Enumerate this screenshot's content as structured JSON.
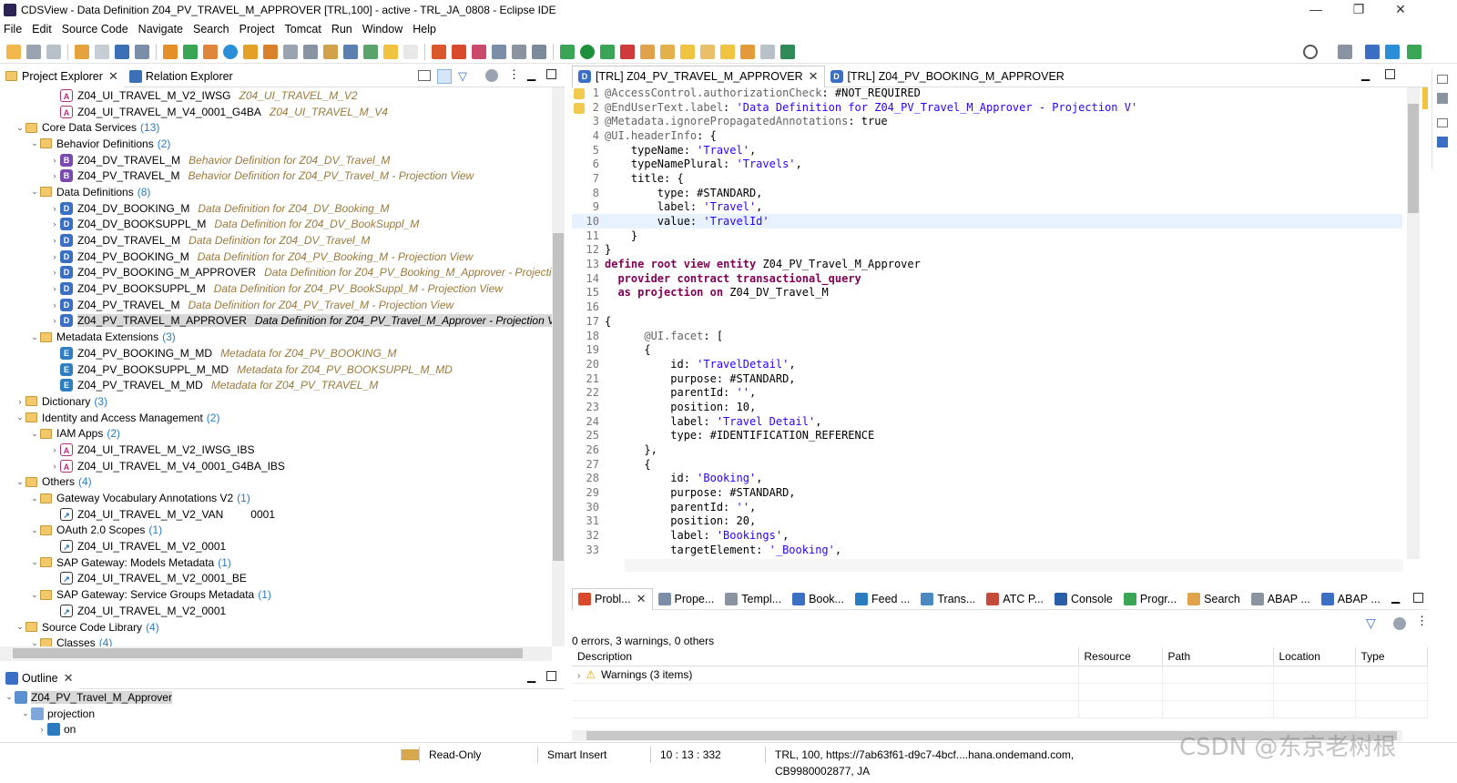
{
  "window": {
    "title": "CDSView - Data Definition Z04_PV_TRAVEL_M_APPROVER [TRL,100] - active - TRL_JA_0808 - Eclipse IDE",
    "minimize": "—",
    "restore": "❐",
    "close": "✕"
  },
  "menu": [
    "File",
    "Edit",
    "Source Code",
    "Navigate",
    "Search",
    "Project",
    "Tomcat",
    "Run",
    "Window",
    "Help"
  ],
  "left_tabs": {
    "project_explorer": "Project Explorer",
    "relation_explorer": "Relation Explorer"
  },
  "tree": [
    {
      "lvl": 3,
      "tw": "",
      "icon": "A",
      "name": "Z04_UI_TRAVEL_M_V2_IWSG",
      "desc": "Z04_UI_TRAVEL_M_V2"
    },
    {
      "lvl": 3,
      "tw": "",
      "icon": "A",
      "name": "Z04_UI_TRAVEL_M_V4_0001_G4BA",
      "desc": "Z04_UI_TRAVEL_M_V4"
    },
    {
      "lvl": 1,
      "tw": "v",
      "icon": "folder",
      "name": "Core Data Services",
      "count": "(13)"
    },
    {
      "lvl": 2,
      "tw": "v",
      "icon": "folder",
      "name": "Behavior Definitions",
      "count": "(2)"
    },
    {
      "lvl": 3,
      "tw": ">",
      "icon": "B",
      "name": "Z04_DV_TRAVEL_M",
      "desc": "Behavior Definition for Z04_DV_Travel_M"
    },
    {
      "lvl": 3,
      "tw": ">",
      "icon": "B",
      "name": "Z04_PV_TRAVEL_M",
      "desc": "Behavior Definition for Z04_PV_Travel_M - Projection View"
    },
    {
      "lvl": 2,
      "tw": "v",
      "icon": "folder",
      "name": "Data Definitions",
      "count": "(8)"
    },
    {
      "lvl": 3,
      "tw": ">",
      "icon": "D",
      "name": "Z04_DV_BOOKING_M",
      "desc": "Data Definition for Z04_DV_Booking_M"
    },
    {
      "lvl": 3,
      "tw": ">",
      "icon": "D",
      "name": "Z04_DV_BOOKSUPPL_M",
      "desc": "Data Definition for Z04_DV_BookSuppl_M"
    },
    {
      "lvl": 3,
      "tw": ">",
      "icon": "D",
      "name": "Z04_DV_TRAVEL_M",
      "desc": "Data Definition for Z04_DV_Travel_M"
    },
    {
      "lvl": 3,
      "tw": ">",
      "icon": "D",
      "name": "Z04_PV_BOOKING_M",
      "desc": "Data Definition for Z04_PV_Booking_M - Projection View"
    },
    {
      "lvl": 3,
      "tw": ">",
      "icon": "D",
      "name": "Z04_PV_BOOKING_M_APPROVER",
      "desc": "Data Definition for Z04_PV_Booking_M_Approver - Projectio"
    },
    {
      "lvl": 3,
      "tw": ">",
      "icon": "D",
      "name": "Z04_PV_BOOKSUPPL_M",
      "desc": "Data Definition for Z04_PV_BookSuppl_M - Projection View"
    },
    {
      "lvl": 3,
      "tw": ">",
      "icon": "D",
      "name": "Z04_PV_TRAVEL_M",
      "desc": "Data Definition for Z04_PV_Travel_M - Projection View"
    },
    {
      "lvl": 3,
      "tw": ">",
      "icon": "D",
      "name": "Z04_PV_TRAVEL_M_APPROVER",
      "desc": "Data Definition for Z04_PV_Travel_M_Approver - Projection V",
      "sel": true
    },
    {
      "lvl": 2,
      "tw": "v",
      "icon": "folder",
      "name": "Metadata Extensions",
      "count": "(3)"
    },
    {
      "lvl": 3,
      "tw": "",
      "icon": "E",
      "name": "Z04_PV_BOOKING_M_MD",
      "desc": "Metadata for Z04_PV_BOOKING_M"
    },
    {
      "lvl": 3,
      "tw": "",
      "icon": "E",
      "name": "Z04_PV_BOOKSUPPL_M_MD",
      "desc": "Metadata for Z04_PV_BOOKSUPPL_M_MD"
    },
    {
      "lvl": 3,
      "tw": "",
      "icon": "E",
      "name": "Z04_PV_TRAVEL_M_MD",
      "desc": "Metadata for Z04_PV_TRAVEL_M"
    },
    {
      "lvl": 1,
      "tw": ">",
      "icon": "folder",
      "name": "Dictionary",
      "count": "(3)"
    },
    {
      "lvl": 1,
      "tw": "v",
      "icon": "folder",
      "name": "Identity and Access Management",
      "count": "(2)"
    },
    {
      "lvl": 2,
      "tw": "v",
      "icon": "folder",
      "name": "IAM Apps",
      "count": "(2)"
    },
    {
      "lvl": 3,
      "tw": ">",
      "icon": "A",
      "name": "Z04_UI_TRAVEL_M_V2_IWSG_IBS"
    },
    {
      "lvl": 3,
      "tw": ">",
      "icon": "A",
      "name": "Z04_UI_TRAVEL_M_V4_0001_G4BA_IBS"
    },
    {
      "lvl": 1,
      "tw": "v",
      "icon": "folder",
      "name": "Others",
      "count": "(4)"
    },
    {
      "lvl": 2,
      "tw": "v",
      "icon": "folder",
      "name": "Gateway Vocabulary Annotations V2",
      "count": "(1)"
    },
    {
      "lvl": 3,
      "tw": "",
      "icon": "V",
      "name": "Z04_UI_TRAVEL_M_V2_VAN",
      "plain": "0001"
    },
    {
      "lvl": 2,
      "tw": "v",
      "icon": "folder",
      "name": "OAuth 2.0 Scopes",
      "count": "(1)"
    },
    {
      "lvl": 3,
      "tw": "",
      "icon": "V",
      "name": "Z04_UI_TRAVEL_M_V2_0001"
    },
    {
      "lvl": 2,
      "tw": "v",
      "icon": "folder",
      "name": "SAP Gateway: Models Metadata",
      "count": "(1)"
    },
    {
      "lvl": 3,
      "tw": "",
      "icon": "V",
      "name": "Z04_UI_TRAVEL_M_V2_0001_BE"
    },
    {
      "lvl": 2,
      "tw": "v",
      "icon": "folder",
      "name": "SAP Gateway: Service Groups Metadata",
      "count": "(1)"
    },
    {
      "lvl": 3,
      "tw": "",
      "icon": "V",
      "name": "Z04_UI_TRAVEL_M_V2_0001"
    },
    {
      "lvl": 1,
      "tw": "v",
      "icon": "folder",
      "name": "Source Code Library",
      "count": "(4)"
    },
    {
      "lvl": 2,
      "tw": "v",
      "icon": "folder",
      "name": "Classes",
      "count": "(4)"
    }
  ],
  "outline": {
    "tab": "Outline",
    "items": [
      {
        "lvl": 0,
        "tw": "v",
        "name": "Z04_PV_Travel_M_Approver",
        "sel": true
      },
      {
        "lvl": 1,
        "tw": "v",
        "name": "projection"
      },
      {
        "lvl": 2,
        "tw": ">",
        "name": "on"
      }
    ]
  },
  "editor": {
    "tabs": [
      "[TRL] Z04_PV_TRAVEL_M_APPROVER",
      "[TRL] Z04_PV_BOOKING_M_APPROVER"
    ],
    "lines": [
      "@AccessControl.authorizationCheck: #NOT_REQUIRED",
      "@EndUserText.label: 'Data Definition for Z04_PV_Travel_M_Approver - Projection V'",
      "@Metadata.ignorePropagatedAnnotations: true",
      "@UI.headerInfo: {",
      "    typeName: 'Travel',",
      "    typeNamePlural: 'Travels',",
      "    title: {",
      "        type: #STANDARD,",
      "        label: 'Travel',",
      "        value: 'TravelId'",
      "    }",
      "}",
      "define root view entity Z04_PV_Travel_M_Approver",
      "  provider contract transactional_query",
      "  as projection on Z04_DV_Travel_M",
      "",
      "{",
      "      @UI.facet: [",
      "      {",
      "          id: 'TravelDetail',",
      "          purpose: #STANDARD,",
      "          parentId: '',",
      "          position: 10,",
      "          label: 'Travel Detail',",
      "          type: #IDENTIFICATION_REFERENCE",
      "      },",
      "      {",
      "          id: 'Booking',",
      "          purpose: #STANDARD,",
      "          parentId: '',",
      "          position: 20,",
      "          label: 'Bookings',",
      "          targetElement: '_Booking',"
    ],
    "highlight_line": 10
  },
  "bottom": {
    "tabs": [
      "Probl...",
      "Prope...",
      "Templ...",
      "Book...",
      "Feed ...",
      "Trans...",
      "ATC P...",
      "Console",
      "Progr...",
      "Search",
      "ABAP ...",
      "ABAP ..."
    ],
    "summary": "0 errors, 3 warnings, 0 others",
    "columns": [
      "Description",
      "Resource",
      "Path",
      "Location",
      "Type"
    ],
    "rows": [
      {
        "description": "Warnings (3 items)"
      }
    ]
  },
  "status": {
    "mode": "Read-Only",
    "insert": "Smart Insert",
    "position": "10 : 13 : 332",
    "system": "TRL, 100, https://7ab63f61-d9c7-4bcf....hana.ondemand.com, CB9980002877, JA"
  },
  "watermark": "CSDN @东京老树根"
}
